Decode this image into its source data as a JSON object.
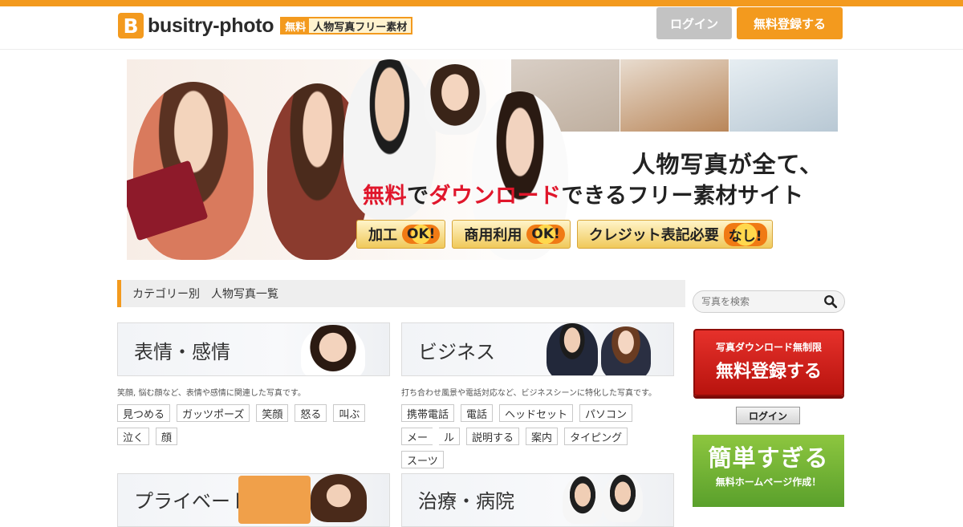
{
  "header": {
    "logo_mark": "B",
    "logo_text": "busitry-photo",
    "logo_free": "無料",
    "logo_desc": "人物写真フリー素材",
    "login_label": "ログイン",
    "register_label": "無料登録する"
  },
  "hero": {
    "headline": "人物写真が全て、",
    "subline_highlight1": "無料",
    "subline_mid1": "で",
    "subline_highlight2": "ダウンロード",
    "subline_rest": "できるフリー素材サイト",
    "badges": [
      {
        "label": "加工",
        "stamp": "OK!"
      },
      {
        "label": "商用利用",
        "stamp": "OK!"
      },
      {
        "label": "クレジット表記必要",
        "stamp": "なし!"
      }
    ]
  },
  "section": {
    "title": "カテゴリー別　人物写真一覧"
  },
  "categories": [
    {
      "title": "表情・感情",
      "description": "笑顔, 悩む顔など、表情や感情に関連した写真です。",
      "tags": [
        "見つめる",
        "ガッツポーズ",
        "笑顔",
        "怒る",
        "叫ぶ",
        "泣く",
        "顔"
      ]
    },
    {
      "title": "ビジネス",
      "description": "打ち合わせ風景や電話対応など、ビジネスシーンに特化した写真です。",
      "tags": [
        "携帯電話",
        "電話",
        "ヘッドセット",
        "パソコン",
        "メー",
        "ル",
        "説明する",
        "案内",
        "タイピング",
        "スーツ"
      ]
    },
    {
      "title": "プライベート"
    },
    {
      "title": "治療・病院"
    }
  ],
  "sidebar": {
    "search_placeholder": "写真を検索",
    "cta_sub": "写真ダウンロード無制限",
    "cta_main": "無料登録する",
    "login_label": "ログイン",
    "ad_big": "簡単すぎる",
    "ad_small": "無料ホームページ作成！"
  },
  "colors": {
    "accent": "#f39a1e",
    "cta_red": "#d8221c",
    "ad_green": "#7cbb36",
    "highlight_red": "#e0162b"
  }
}
